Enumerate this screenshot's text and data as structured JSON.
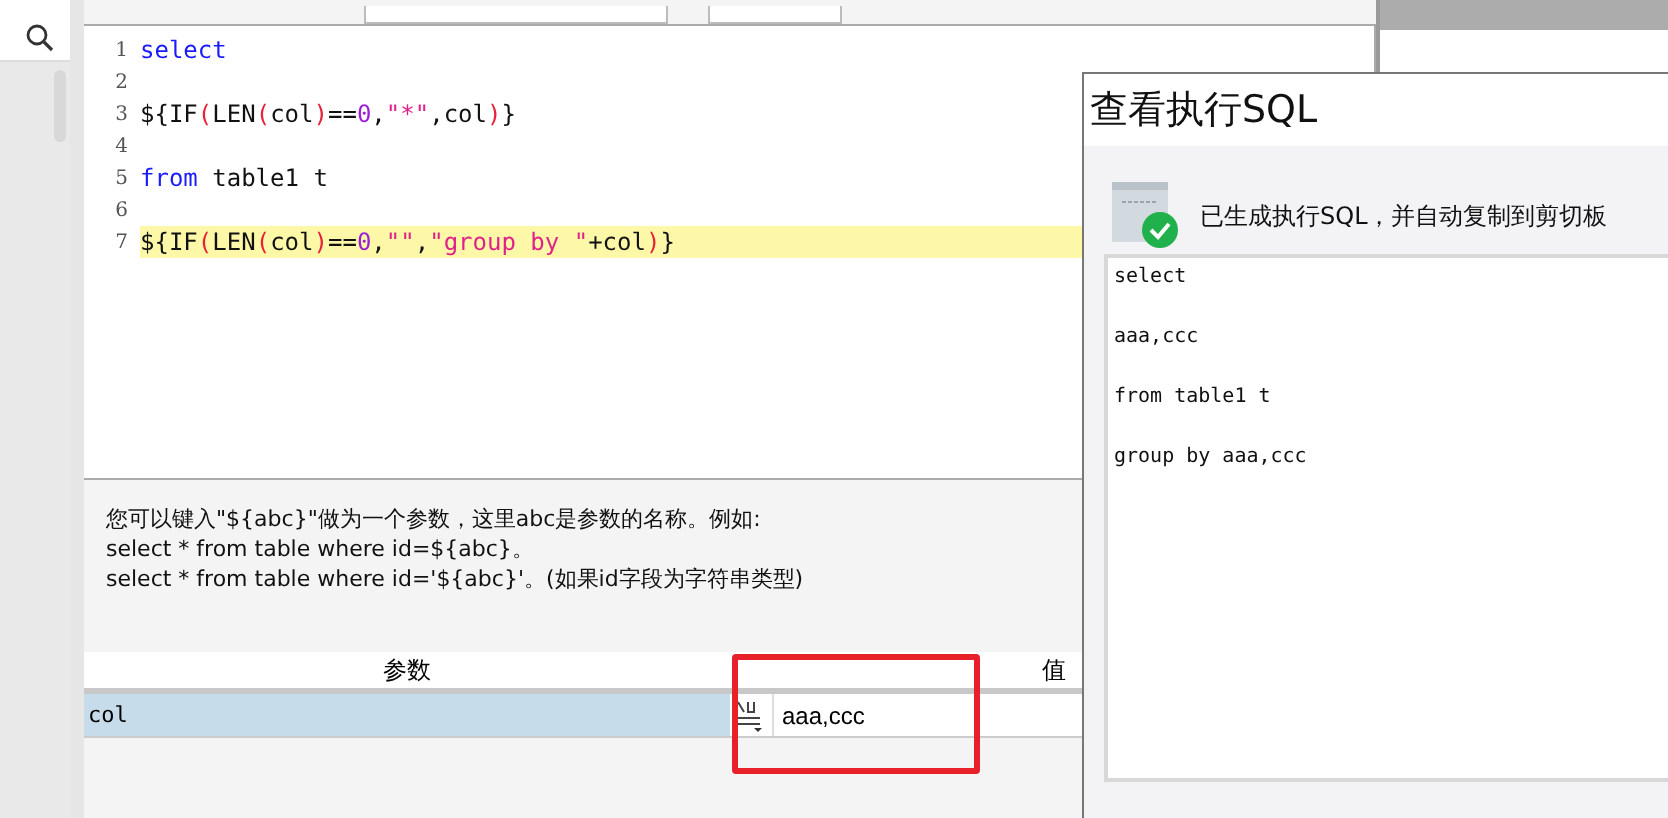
{
  "editor": {
    "lines": [
      {
        "number": "1",
        "highlighted": false,
        "tokens": [
          {
            "kind": "keyword",
            "text": "select"
          }
        ]
      },
      {
        "number": "2",
        "highlighted": false
      },
      {
        "number": "3",
        "highlighted": false,
        "tokens": [
          {
            "kind": "plain",
            "text": "${IF"
          },
          {
            "kind": "paren",
            "text": "("
          },
          {
            "kind": "plain",
            "text": "LEN"
          },
          {
            "kind": "paren",
            "text": "("
          },
          {
            "kind": "plain",
            "text": "col"
          },
          {
            "kind": "paren",
            "text": ")"
          },
          {
            "kind": "plain",
            "text": "=="
          },
          {
            "kind": "number",
            "text": "0"
          },
          {
            "kind": "plain",
            "text": ","
          },
          {
            "kind": "string",
            "text": "\"*\""
          },
          {
            "kind": "plain",
            "text": ",col"
          },
          {
            "kind": "paren",
            "text": ")"
          },
          {
            "kind": "plain",
            "text": "}"
          }
        ]
      },
      {
        "number": "4",
        "highlighted": false
      },
      {
        "number": "5",
        "highlighted": false,
        "tokens": [
          {
            "kind": "keyword",
            "text": "from"
          },
          {
            "kind": "plain",
            "text": " table1 t"
          }
        ]
      },
      {
        "number": "6",
        "highlighted": false
      },
      {
        "number": "7",
        "highlighted": true,
        "tokens": [
          {
            "kind": "plain",
            "text": "${IF"
          },
          {
            "kind": "paren",
            "text": "("
          },
          {
            "kind": "plain",
            "text": "LEN"
          },
          {
            "kind": "paren",
            "text": "("
          },
          {
            "kind": "plain",
            "text": "col"
          },
          {
            "kind": "paren",
            "text": ")"
          },
          {
            "kind": "plain",
            "text": "=="
          },
          {
            "kind": "number",
            "text": "0"
          },
          {
            "kind": "plain",
            "text": ","
          },
          {
            "kind": "string",
            "text": "\"\""
          },
          {
            "kind": "plain",
            "text": ","
          },
          {
            "kind": "string",
            "text": "\"group by \""
          },
          {
            "kind": "plain",
            "text": "+col"
          },
          {
            "kind": "paren",
            "text": ")"
          },
          {
            "kind": "plain",
            "text": "}"
          }
        ]
      }
    ]
  },
  "hint": [
    "您可以键入\"${abc}\"做为一个参数，这里abc是参数的名称。例如:",
    "select * from table where id=${abc}。",
    "select * from table where id='${abc}'。(如果id字段为字符串类型)"
  ],
  "parameters": {
    "columns": [
      "参数",
      "值"
    ],
    "rows": [
      {
        "name": "col",
        "value": "aaa,ccc",
        "selected": true
      }
    ]
  },
  "dialog": {
    "title": "查看执行SQL",
    "message": "已生成执行SQL，并自动复制到剪切板",
    "sql_lines": [
      "select",
      "aaa,ccc",
      "from table1 t",
      "group by aaa,ccc"
    ]
  }
}
